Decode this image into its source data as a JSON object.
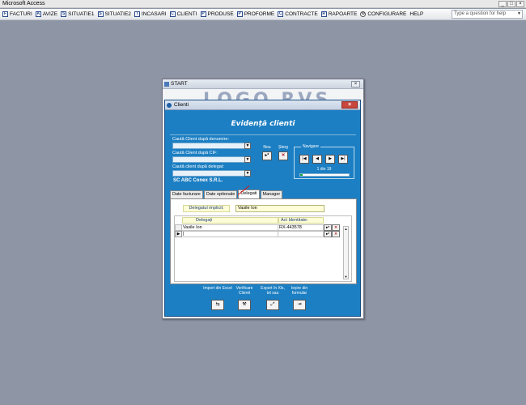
{
  "app": {
    "title": "Microsoft Access"
  },
  "menu": {
    "items": [
      {
        "label": "FACTURI",
        "icon": "F"
      },
      {
        "label": "AVIZE",
        "icon": "A"
      },
      {
        "label": "SITUATIE1",
        "icon": "S"
      },
      {
        "label": "SITUATIE2",
        "icon": "S"
      },
      {
        "label": "INCASARI",
        "icon": "I"
      },
      {
        "label": "CLIENTI",
        "icon": "C"
      },
      {
        "label": "PRODUSE",
        "icon": "P"
      },
      {
        "label": "PROFORME",
        "icon": "P"
      },
      {
        "label": "CONTRACTE",
        "icon": "C"
      },
      {
        "label": "RAPOARTE",
        "icon": "R"
      },
      {
        "label": "CONFIGURARE",
        "icon": "gear-icon"
      },
      {
        "label": "HELP",
        "icon": ""
      }
    ],
    "help_placeholder": "Type a question for help"
  },
  "start_window": {
    "title": "START",
    "logo_text": "LOGO RVS"
  },
  "clienti_window": {
    "title": "Clienti",
    "form_title": "Evidență clienti",
    "search": {
      "by_name_label": "Caută Client după denumire:",
      "by_cif_label": "Caută Client după CIF:",
      "by_delegate_label": "Caută client după delegat:"
    },
    "buttons": {
      "new_label": "Nou",
      "delete_label": "Șterg"
    },
    "navigation": {
      "legend": "Navigare",
      "current": "1",
      "separator": "din",
      "total": "19",
      "progress": 0.05
    },
    "company_name": "SC ABC Conex S.R.L.",
    "tabs": [
      "Date facturare",
      "Date optionale",
      "Delegati",
      "Manager"
    ],
    "active_tab": "Delegati",
    "delegati": {
      "implicit_label": "Delegatul implicit:",
      "implicit_value": "Vasile Ion",
      "columns": [
        "Delegați",
        "Act Identitate:"
      ],
      "rows": [
        {
          "name": "Vasile Ion",
          "id_doc": "RX-443578"
        }
      ]
    },
    "actions": [
      {
        "label": "Import din Excel"
      },
      {
        "label": "Verificare Clienti"
      },
      {
        "label": "Export în Xls, txt sau"
      },
      {
        "label": "Ieșire din formular"
      }
    ]
  }
}
